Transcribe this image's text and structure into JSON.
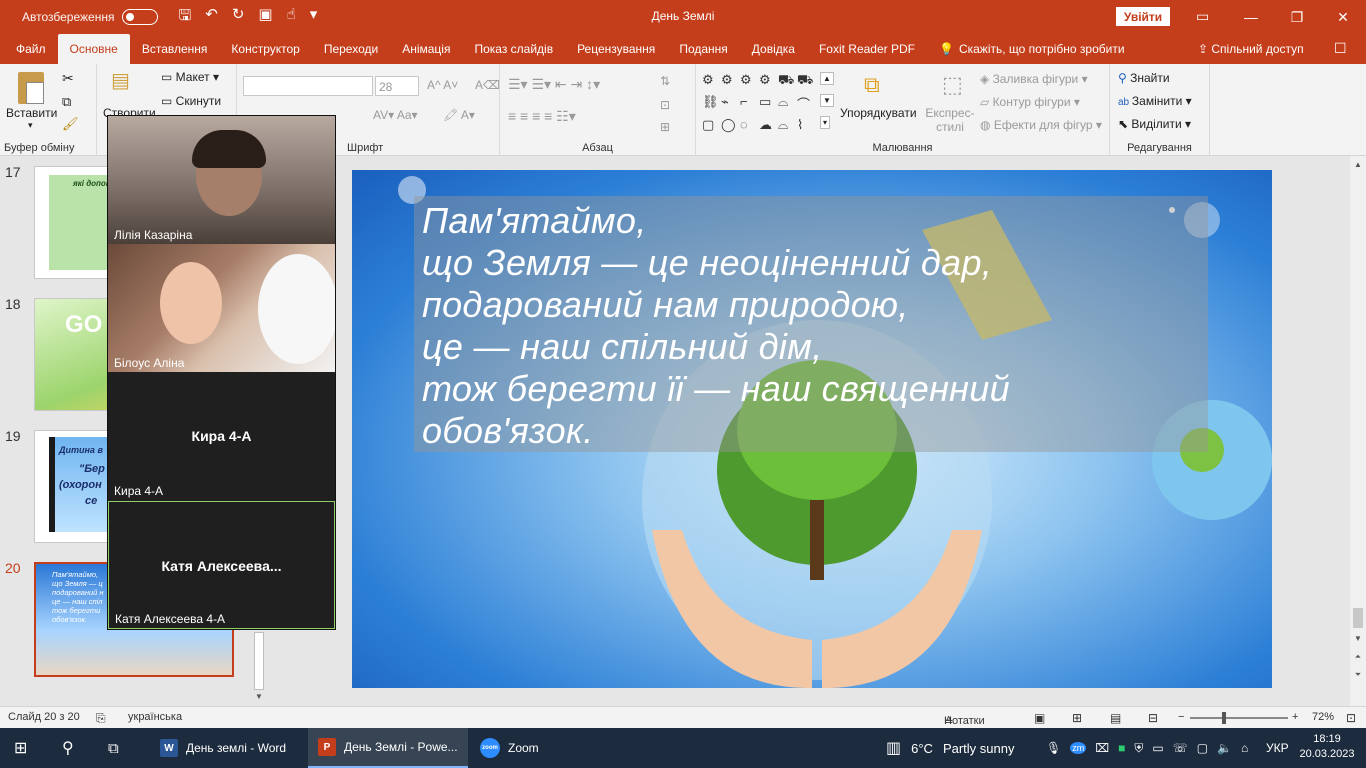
{
  "window": {
    "autosave_label": "Автозбереження",
    "title": "День Землі",
    "signin_label": "Увійти"
  },
  "tabs": [
    "Файл",
    "Основне",
    "Вставлення",
    "Конструктор",
    "Переходи",
    "Анімація",
    "Показ слайдів",
    "Рецензування",
    "Подання",
    "Довідка",
    "Foxit Reader PDF"
  ],
  "tell_me": "Скажіть, що потрібно зробити",
  "share_label": "Спільний доступ",
  "ribbon": {
    "paste": "Вставити",
    "clipboard_group": "Буфер обміну",
    "new_slide_partial": "Створити",
    "layout": "Макет",
    "reset": "Скинути",
    "font_size": "28",
    "font_group": "Шрифт",
    "paragraph_group": "Абзац",
    "arrange": "Упорядкувати",
    "quick_styles": "Експрес-стилі",
    "shape_fill": "Заливка фігури",
    "shape_outline": "Контур фігури",
    "shape_effects": "Ефекти для фігур",
    "drawing_group": "Малювання",
    "find": "Знайти",
    "replace": "Замінити",
    "select": "Виділити",
    "editing_group": "Редагування"
  },
  "thumbnails": [
    {
      "num": "17",
      "title": "які допомо"
    },
    {
      "num": "18",
      "title": "GO"
    },
    {
      "num": "19",
      "title": "Дитина в",
      "line2": "\"Бер",
      "line3": "(охорон",
      "line4": "се"
    },
    {
      "num": "20",
      "text": "Пам'ятаймо,\nщо Земля — ц\nподарований н\nце — наш спіл\nтож берегти\nобов'язок."
    }
  ],
  "zoom": {
    "participants": [
      {
        "caption": "Лілія Казаріна",
        "name": ""
      },
      {
        "caption": "Білоус Аліна",
        "name": ""
      },
      {
        "caption": "Кира 4-А",
        "name": "Кира 4-А"
      },
      {
        "caption": "Катя Алексеева 4-А",
        "name": "Катя  Алексеева..."
      }
    ]
  },
  "slide": {
    "lines": [
      "Пам'ятаймо,",
      "що Земля — це неоціненний дар,",
      "подарований нам природою,",
      "це — наш спільний дім,",
      "тож берегти її — наш священний",
      "обов'язок."
    ]
  },
  "status": {
    "slide_of": "Слайд 20 з 20",
    "language": "українська",
    "notes": "Нотатки",
    "zoom": "72%"
  },
  "taskbar": {
    "apps": [
      {
        "label": "День землі - Word",
        "icon": "W"
      },
      {
        "label": "День Землі - Powe...",
        "icon": "P"
      },
      {
        "label": "Zoom",
        "icon": "zoom"
      }
    ],
    "weather_temp": "6°C",
    "weather_text": "Partly sunny",
    "lang": "УКР",
    "time": "18:19",
    "date": "20.03.2023"
  },
  "colors": {
    "accent": "#c43e1c",
    "taskbar": "#1c2b3d"
  }
}
